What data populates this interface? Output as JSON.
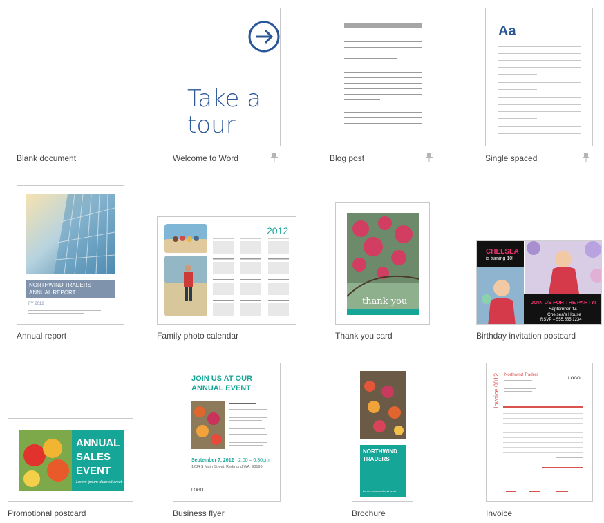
{
  "templates": [
    {
      "label": "Blank document"
    },
    {
      "label": "Welcome to Word",
      "thumb": {
        "tour_text": "Take a tour"
      }
    },
    {
      "label": "Blog post"
    },
    {
      "label": "Single spaced",
      "thumb": {
        "heading": "Aa"
      }
    },
    {
      "label": "Annual report",
      "thumb": {
        "banner_line1": "NORTHWIND TRADERS",
        "banner_line2": "ANNUAL REPORT",
        "year": "FY 2012"
      }
    },
    {
      "label": "Family photo calendar",
      "thumb": {
        "year": "2012"
      }
    },
    {
      "label": "Thank you card",
      "thumb": {
        "text": "thank you"
      }
    },
    {
      "label": "Birthday invitation postcard",
      "thumb": {
        "name": "CHELSEA",
        "sub": "is turning 10!",
        "join": "JOIN US FOR THE PARTY!",
        "date": "September 14",
        "place": "Chelsea's House",
        "rsvp": "RSVP – 555.555.1234"
      }
    },
    {
      "label": "Promotional postcard",
      "thumb": {
        "line1": "ANNUAL",
        "line2": "SALES",
        "line3": "EVENT",
        "tagline": "Lorem ipsum dolor sit amet"
      }
    },
    {
      "label": "Business flyer",
      "thumb": {
        "heading1": "JOIN US AT OUR",
        "heading2": "ANNUAL EVENT",
        "date": "September 7, 2012",
        "time": "2:00 – 6:30pm",
        "address": "1234 S Main Street, Redmond WA, 98190",
        "logo": "LOGO"
      }
    },
    {
      "label": "Brochure",
      "thumb": {
        "line1": "NORTHWIND",
        "line2": "TRADERS",
        "tagline": "Lorem ipsum dolor sit amet"
      }
    },
    {
      "label": "Invoice",
      "thumb": {
        "company": "Northwind Traders",
        "vertical": "Invoice 0012",
        "logo": "LOGO"
      }
    }
  ],
  "colors": {
    "accent_blue": "#2b5797",
    "teal": "#16a697",
    "pink": "#e8336b",
    "invoice_red": "#d9534f"
  }
}
